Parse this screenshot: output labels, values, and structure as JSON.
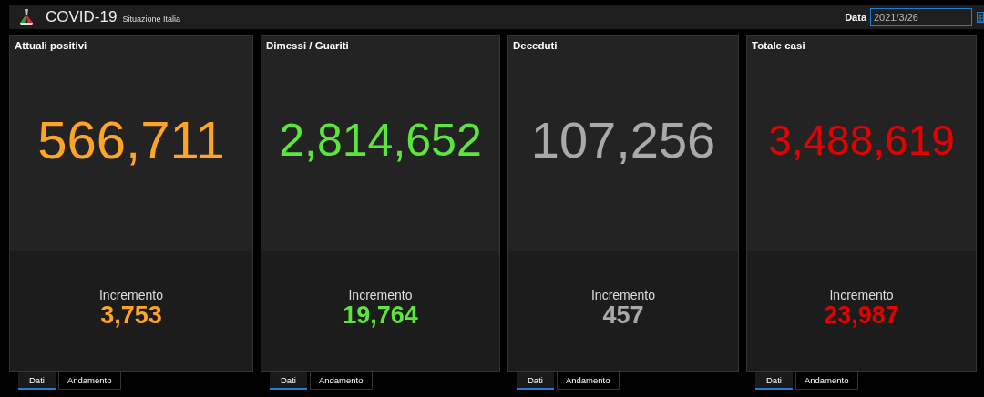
{
  "header": {
    "title": "COVID-19",
    "subtitle": "Situazione Italia",
    "date_label": "Data",
    "date_value": "2021/3/26"
  },
  "cards": [
    {
      "title": "Attuali positivi",
      "value": "566,711",
      "increment_label": "Incremento",
      "increment": "3,753",
      "color": "#ffa523",
      "tabs": [
        {
          "label": "Dati",
          "selected": true
        },
        {
          "label": "Andamento",
          "selected": false
        }
      ]
    },
    {
      "title": "Dimessi / Guariti",
      "value": "2,814,652",
      "increment_label": "Incremento",
      "increment": "19,764",
      "color": "#5ce53a",
      "tabs": [
        {
          "label": "Dati",
          "selected": true
        },
        {
          "label": "Andamento",
          "selected": false
        }
      ]
    },
    {
      "title": "Deceduti",
      "value": "107,256",
      "increment_label": "Incremento",
      "increment": "457",
      "color": "#a9a9a9",
      "tabs": [
        {
          "label": "Dati",
          "selected": true
        },
        {
          "label": "Andamento",
          "selected": false
        }
      ]
    },
    {
      "title": "Totale casi",
      "value": "3,488,619",
      "increment_label": "Incremento",
      "increment": "23,987",
      "color": "#e60000",
      "tabs": [
        {
          "label": "Dati",
          "selected": true
        },
        {
          "label": "Andamento",
          "selected": false
        }
      ]
    }
  ]
}
